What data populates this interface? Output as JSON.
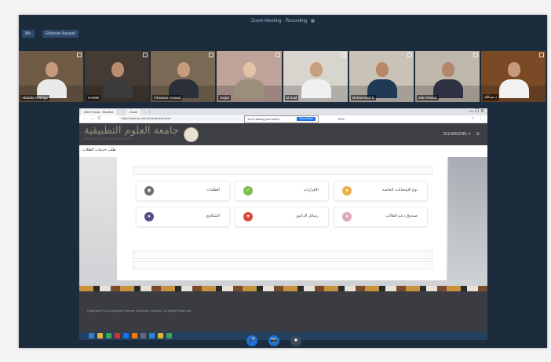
{
  "zoom": {
    "topbar_title": "Zoom Meeting · Recording",
    "pills": [
      "Mic",
      "Ghassan Assaad"
    ]
  },
  "participants": [
    {
      "name": "Abdulla Al Bloga",
      "bg": "#6f5a46",
      "skin": "#c59a7c",
      "shirt": "#e9e9e9"
    },
    {
      "name": "HIHOE",
      "bg": "#463a34",
      "skin": "#b88d6e",
      "shirt": "#3b3b3b"
    },
    {
      "name": "Ghassan Assaad",
      "bg": "#7a6a55",
      "skin": "#c69c7e",
      "shirt": "#2b2f3a"
    },
    {
      "name": "Sajad",
      "bg": "#bfa29a",
      "skin": "#e3c4a5",
      "shirt": "#9a8f79"
    },
    {
      "name": "M.Zaid",
      "bg": "#d8d5cf",
      "skin": "#c8a081",
      "shirt": "#f0f0f0"
    },
    {
      "name": "Mohammed K",
      "bg": "#c9c3b7",
      "skin": "#b88866",
      "shirt": "#1f3a56"
    },
    {
      "name": "Zaki Khaled",
      "bg": "#bfb7ab",
      "skin": "#b3876a",
      "shirt": "#2d3142"
    },
    {
      "name": "د.عبدالله",
      "bg": "#7a4a26",
      "skin": "#c79a7b",
      "shirt": "#f2f2f2"
    }
  ],
  "browser": {
    "tabs": [
      "ASU Portal - Student",
      "Zoom",
      "+"
    ],
    "url": "https://www.asu.edu.bh/student/services",
    "zoom_popup": "You're sharing your screen",
    "stop_label": "Stop Share",
    "zoom_value": "80%",
    "nav_back": "←",
    "nav_forward": "→",
    "nav_reload": "C",
    "window_controls": "— ☐ ✕",
    "menu": "☆ ⋮"
  },
  "site": {
    "title": "جامعة العلوم التطبيقية",
    "subtitle": "APPLIED SCIENCE UNIVERSITY",
    "user": "20190002081 ▾",
    "user_icon": "☰",
    "breadcrumb": "طلب خدمات الطلاب"
  },
  "services": [
    {
      "label": "نوع الإمتحانات الخاصة",
      "color": "#e9b04c",
      "icon": "●"
    },
    {
      "label": "الإقرارات",
      "color": "#7bbf4e",
      "icon": "✓"
    },
    {
      "label": "الطلبات",
      "color": "#6e6e6e",
      "icon": "◉"
    },
    {
      "label": "صندوق دعم الطالب",
      "color": "#e0a7b4",
      "icon": "●"
    },
    {
      "label": "رسائل الدكتور",
      "color": "#d84a3a",
      "icon": "♥"
    },
    {
      "label": "الشكاوى",
      "color": "#5a4a8a",
      "icon": "●"
    }
  ],
  "footer": {
    "copyright": "Copyright © 2018 Applied Science University, Bahrain. All Rights Reserved."
  },
  "taskbar_colors": [
    "#2c82d6",
    "#e0b23a",
    "#3aa757",
    "#d93025",
    "#1a73e8",
    "#ff7a00",
    "#6b6b6b",
    "#2c82d6",
    "#e0b23a",
    "#3aa757"
  ],
  "controls": [
    "🎤",
    "📷",
    "⏹"
  ]
}
